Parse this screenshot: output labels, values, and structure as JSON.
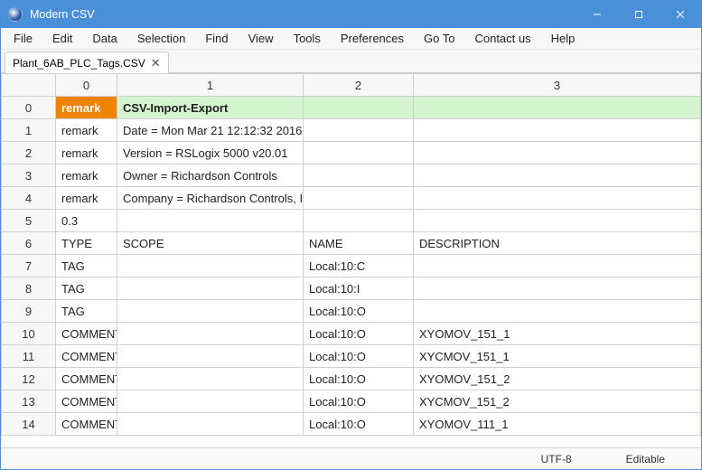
{
  "app": {
    "title": "Modern CSV"
  },
  "menu": [
    "File",
    "Edit",
    "Data",
    "Selection",
    "Find",
    "View",
    "Tools",
    "Preferences",
    "Go To",
    "Contact us",
    "Help"
  ],
  "tab": {
    "label": "Plant_6AB_PLC_Tags.CSV",
    "close": "✕"
  },
  "columns": [
    "0",
    "1",
    "2",
    "3"
  ],
  "rows": [
    {
      "h": "0",
      "c": [
        "remark",
        "CSV-Import-Export",
        "",
        ""
      ],
      "sel": true
    },
    {
      "h": "1",
      "c": [
        "remark",
        "Date = Mon Mar 21 12:12:32 2016",
        "",
        ""
      ]
    },
    {
      "h": "2",
      "c": [
        "remark",
        "Version = RSLogix 5000 v20.01",
        "",
        ""
      ]
    },
    {
      "h": "3",
      "c": [
        "remark",
        "Owner = Richardson Controls",
        "",
        ""
      ]
    },
    {
      "h": "4",
      "c": [
        "remark",
        "Company = Richardson Controls, Inc",
        "",
        ""
      ]
    },
    {
      "h": "5",
      "c": [
        "0.3",
        "",
        "",
        ""
      ]
    },
    {
      "h": "6",
      "c": [
        "TYPE",
        "SCOPE",
        "NAME",
        "DESCRIPTION"
      ]
    },
    {
      "h": "7",
      "c": [
        "TAG",
        "",
        "Local:10:C",
        ""
      ]
    },
    {
      "h": "8",
      "c": [
        "TAG",
        "",
        "Local:10:I",
        ""
      ]
    },
    {
      "h": "9",
      "c": [
        "TAG",
        "",
        "Local:10:O",
        ""
      ]
    },
    {
      "h": "10",
      "c": [
        "COMMENT",
        "",
        "Local:10:O",
        "XYOMOV_151_1"
      ]
    },
    {
      "h": "11",
      "c": [
        "COMMENT",
        "",
        "Local:10:O",
        "XYCMOV_151_1"
      ]
    },
    {
      "h": "12",
      "c": [
        "COMMENT",
        "",
        "Local:10:O",
        "XYOMOV_151_2"
      ]
    },
    {
      "h": "13",
      "c": [
        "COMMENT",
        "",
        "Local:10:O",
        "XYCMOV_151_2"
      ]
    },
    {
      "h": "14",
      "c": [
        "COMMENT",
        "",
        "Local:10:O",
        "XYOMOV_111_1"
      ]
    }
  ],
  "status": {
    "encoding": "UTF-8",
    "mode": "Editable"
  }
}
